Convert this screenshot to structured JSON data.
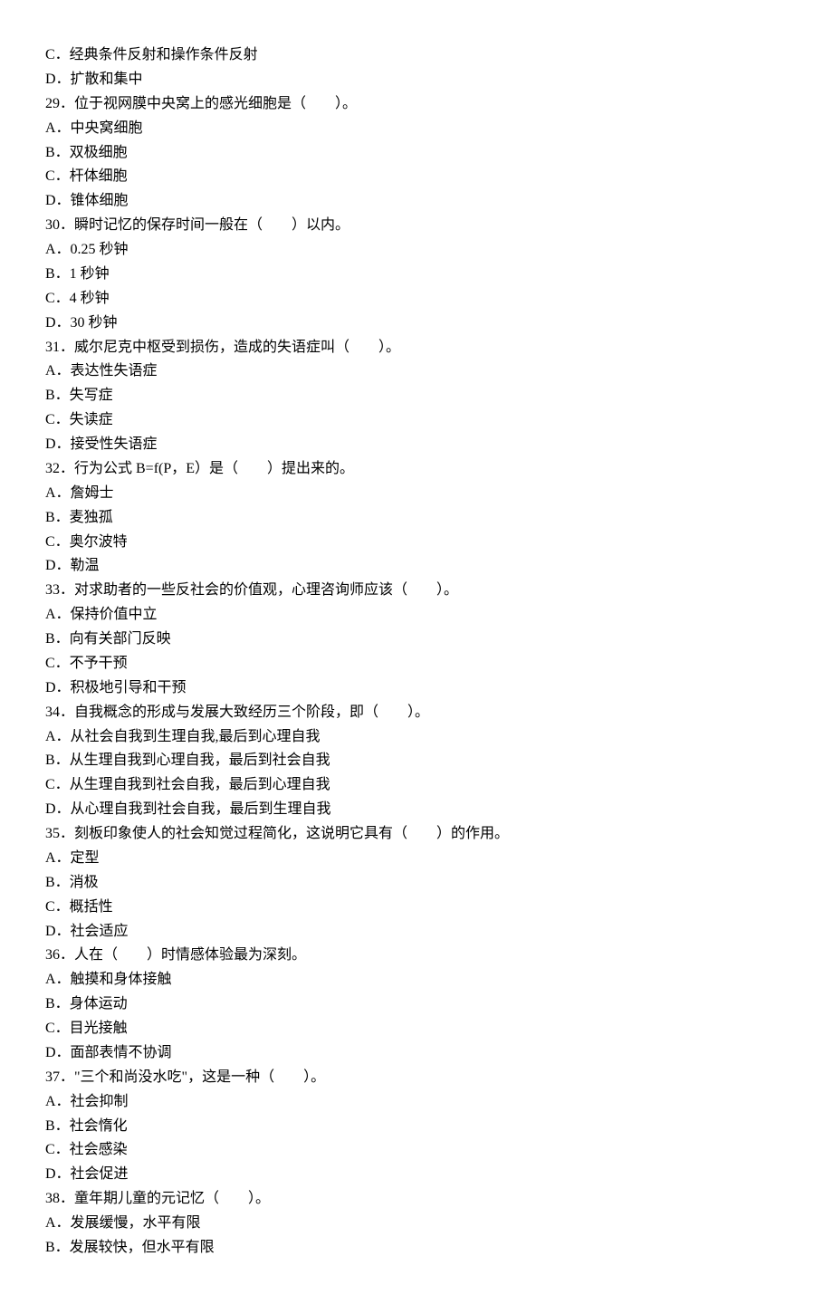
{
  "lines": [
    "C．经典条件反射和操作条件反射",
    "D．扩散和集中",
    "29．位于视网膜中央窝上的感光细胞是（　　）。",
    "A．中央窝细胞",
    "B．双极细胞",
    "C．杆体细胞",
    "D．锥体细胞",
    "30．瞬时记忆的保存时间一般在（　　）以内。",
    "A．0.25 秒钟",
    "B．1 秒钟",
    "C．4 秒钟",
    "D．30 秒钟",
    "31．威尔尼克中枢受到损伤，造成的失语症叫（　　）。",
    "A．表达性失语症",
    "B．失写症",
    "C．失读症",
    "D．接受性失语症",
    "32．行为公式 B=f(P，E）是（　　）提出来的。",
    "A．詹姆士",
    "B．麦独孤",
    "C．奥尔波特",
    "D．勒温",
    "33．对求助者的一些反社会的价值观，心理咨询师应该（　　）。",
    "A．保持价值中立",
    "B．向有关部门反映",
    "C．不予干预",
    "D．积极地引导和干预",
    "34．自我概念的形成与发展大致经历三个阶段，即（　　）。",
    "A．从社会自我到生理自我,最后到心理自我",
    "B．从生理自我到心理自我，最后到社会自我",
    "C．从生理自我到社会自我，最后到心理自我",
    "D．从心理自我到社会自我，最后到生理自我",
    "35．刻板印象使人的社会知觉过程简化，这说明它具有（　　）的作用。",
    "A．定型",
    "B．消极",
    "C．概括性",
    "D．社会适应",
    "36．人在（　　）时情感体验最为深刻。",
    "A．触摸和身体接触",
    "B．身体运动",
    "C．目光接触",
    "D．面部表情不协调",
    "37．\"三个和尚没水吃\"，这是一种（　　）。",
    "A．社会抑制",
    "B．社会惰化",
    "C．社会感染",
    "D．社会促进",
    "38．童年期儿童的元记忆（　　）。",
    "A．发展缓慢，水平有限",
    "B．发展较快，但水平有限"
  ]
}
